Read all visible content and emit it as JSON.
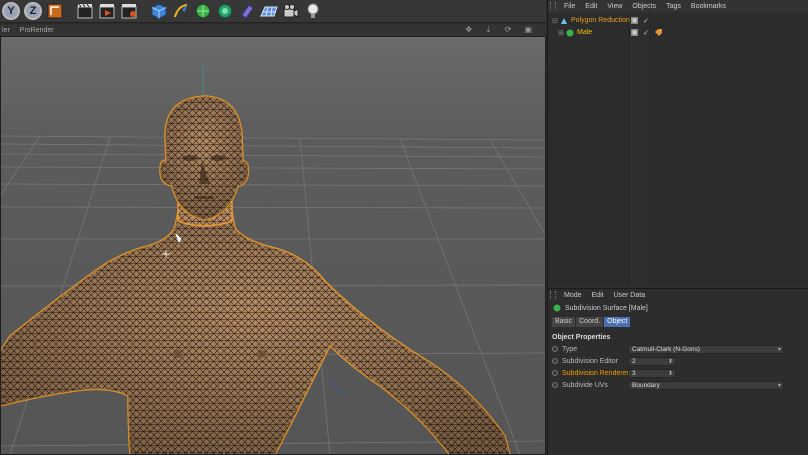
{
  "toolbar": {
    "buttons": [
      {
        "icon": "y-axis-icon",
        "label": "Y"
      },
      {
        "icon": "z-axis-icon",
        "label": "Z"
      },
      {
        "icon": "coordinate-system-icon"
      },
      {
        "icon": "render-view-icon"
      },
      {
        "icon": "render-picture-viewer-icon"
      },
      {
        "icon": "render-settings-icon"
      },
      {
        "icon": "cube-icon"
      },
      {
        "icon": "pen-spline-icon"
      },
      {
        "icon": "subdivision-surface-icon"
      },
      {
        "icon": "cloner-icon"
      },
      {
        "icon": "deformer-icon"
      },
      {
        "icon": "floor-icon"
      },
      {
        "icon": "camera-icon"
      },
      {
        "icon": "light-icon"
      }
    ]
  },
  "viewport": {
    "menu": [
      "ler",
      "ProRender"
    ]
  },
  "object_manager": {
    "menu": [
      "File",
      "Edit",
      "View",
      "Objects",
      "Tags",
      "Bookmarks"
    ],
    "rows": [
      {
        "name": "Polygon Reduction",
        "indent": 0
      },
      {
        "name": "Male",
        "indent": 1
      }
    ]
  },
  "attributes": {
    "menu": [
      "Mode",
      "Edit",
      "User Data"
    ],
    "title": "Subdivision Surface [Male]",
    "tabs": [
      "Basic",
      "Coord.",
      "Object"
    ],
    "active_tab": "Object",
    "section": "Object Properties",
    "properties": [
      {
        "label": "Type",
        "value": "Catmull-Clark (N-Gons)",
        "kind": "dropdown"
      },
      {
        "label": "Subdivision Editor",
        "value": "2",
        "kind": "number"
      },
      {
        "label": "Subdivision Renderer",
        "value": "3",
        "kind": "number",
        "highlight": true
      },
      {
        "label": "Subdivide UVs",
        "value": "Boundary",
        "kind": "dropdown"
      }
    ]
  },
  "colors": {
    "accent_orange": "#f0a000",
    "active_tab": "#4b6fb0"
  }
}
